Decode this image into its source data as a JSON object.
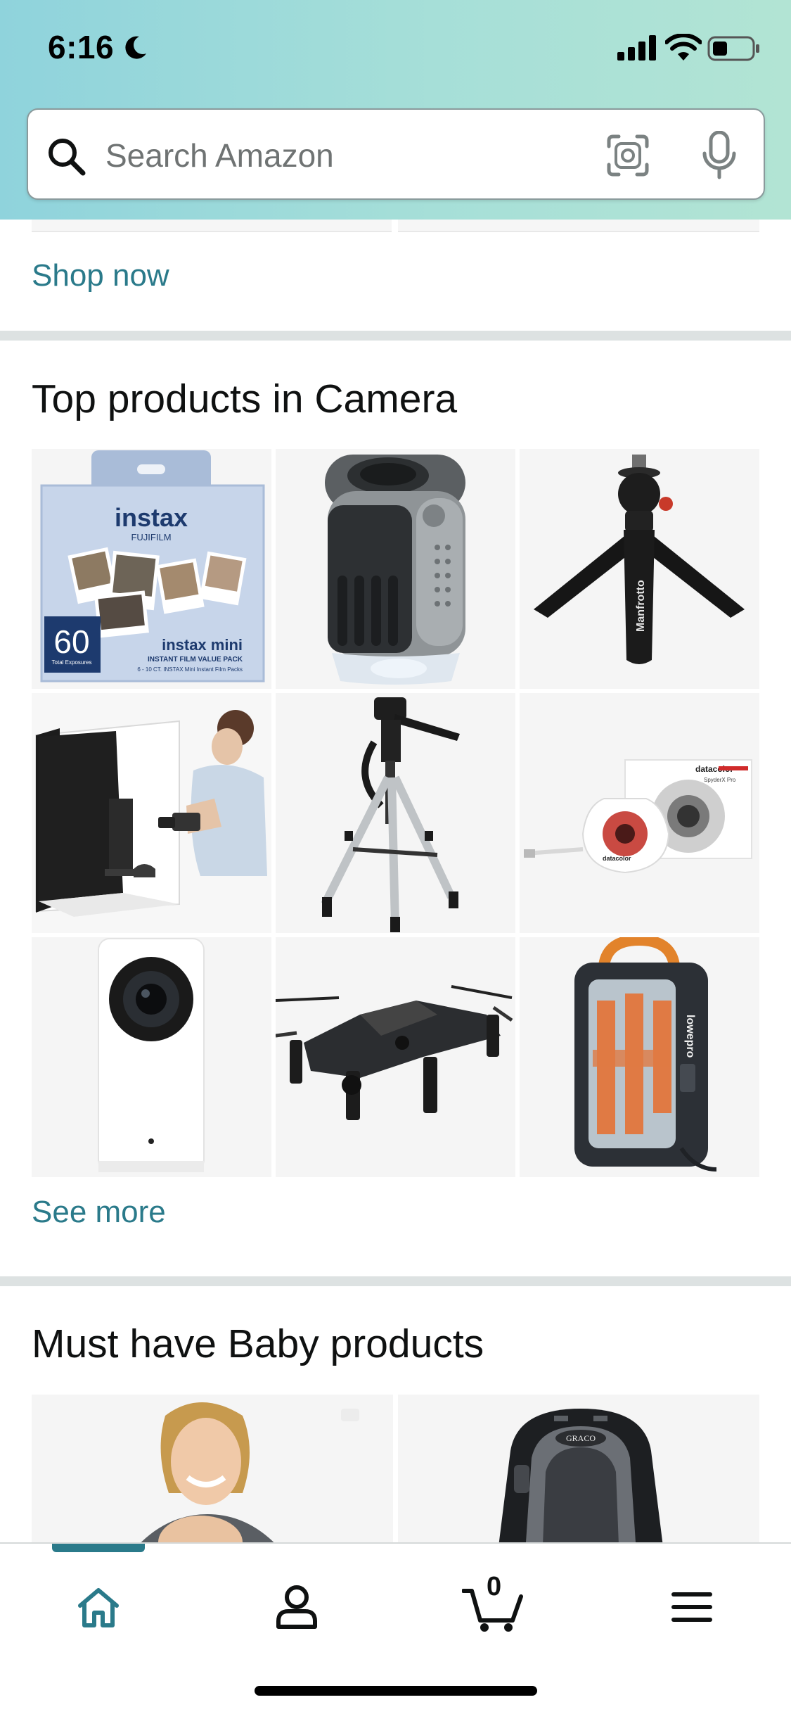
{
  "status_bar": {
    "time": "6:16"
  },
  "search": {
    "placeholder": "Search Amazon"
  },
  "prev_section": {
    "link_label": "Shop now"
  },
  "camera_section": {
    "title": "Top products in Camera",
    "link_label": "See more",
    "products": [
      {
        "name": "instax-film-pack-tile"
      },
      {
        "name": "pocket-microscope-tile"
      },
      {
        "name": "mini-tripod-tile"
      },
      {
        "name": "photo-light-box-tile"
      },
      {
        "name": "camera-tripod-tile"
      },
      {
        "name": "color-calibrator-tile"
      },
      {
        "name": "security-camera-tile"
      },
      {
        "name": "drone-tile"
      },
      {
        "name": "camera-pouch-tile"
      }
    ],
    "tile_texts": {
      "instax_brand": "instax",
      "fujifilm": "FUJIFILM",
      "count": "60",
      "count_sub": "Total Exposures",
      "mini_label": "instax mini",
      "value_pack": "INSTANT FILM VALUE PACK",
      "pack_detail": "6 - 10 CT. INSTAX Mini Instant Film Packs",
      "tripod_brand": "Manfrotto",
      "calibrator_brand": "datacolor",
      "calibrator_model": "SpyderX Pro",
      "pouch_brand": "lowepro"
    }
  },
  "baby_section": {
    "title": "Must have Baby products",
    "seat_brand": "GRACO"
  },
  "bottom_nav": {
    "cart_count": "0"
  },
  "colors": {
    "link": "#2a7a8a",
    "header_gradient_start": "#8fd3dc",
    "header_gradient_end": "#b2e4d4",
    "divider": "#dde2e2"
  }
}
